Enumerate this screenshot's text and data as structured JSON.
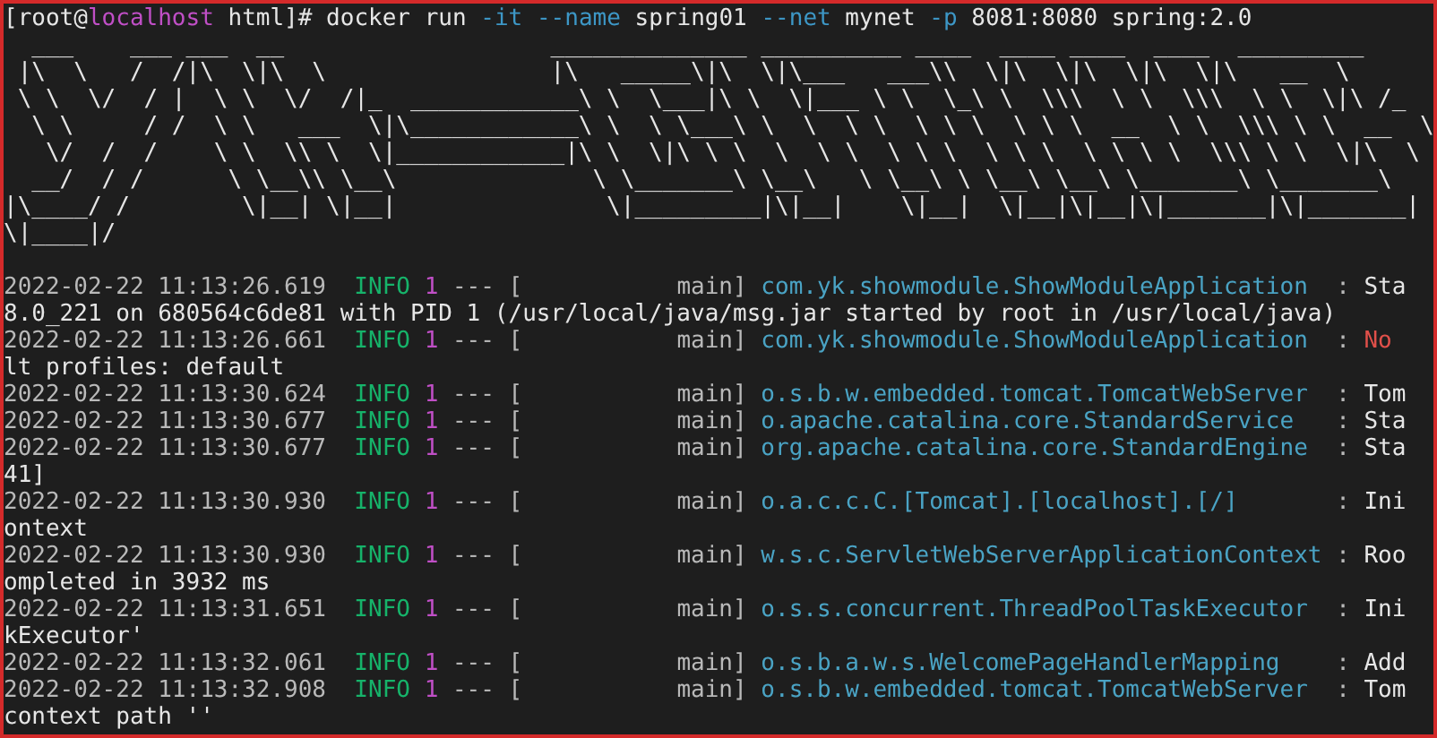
{
  "prompt": {
    "before": "[root@",
    "host": "localhost",
    "after": " html]#"
  },
  "command": [
    {
      "text": "docker",
      "kind": "arg"
    },
    {
      "text": "run",
      "kind": "arg"
    },
    {
      "text": "-it",
      "kind": "flag"
    },
    {
      "text": "--name",
      "kind": "flag"
    },
    {
      "text": "spring01",
      "kind": "arg"
    },
    {
      "text": "--net",
      "kind": "flag"
    },
    {
      "text": "mynet",
      "kind": "arg"
    },
    {
      "text": "-p",
      "kind": "flag"
    },
    {
      "text": "8081:8080",
      "kind": "arg"
    },
    {
      "text": "spring:2.0",
      "kind": "arg"
    }
  ],
  "banner": [
    "  ___    ___ ___  __                   ______________ __________ ____  ____ ____  ____  _________",
    " |\\  \\   /  /|\\  \\|\\  \\                |\\   _____\\|\\  \\|\\___   ___\\\\  \\|\\  \\|\\  \\|\\  \\|\\   __  \\",
    " \\ \\  \\/  / |  \\ \\  \\/  /|_  ____________\\ \\  \\___|\\ \\  \\|___ \\ \\  \\_\\ \\  \\\\\\  \\ \\  \\\\\\  \\ \\  \\|\\ /_",
    "  \\ \\     / /  \\ \\   ___  \\|\\____________\\ \\  \\ \\___\\ \\  \\  \\ \\  \\ \\ \\  \\ \\ \\  __  \\ \\  \\\\\\ \\ \\  __  \\",
    "   \\/  /  /    \\ \\  \\\\ \\  \\|____________|\\ \\  \\|\\ \\ \\  \\  \\ \\  \\ \\ \\  \\ \\ \\  \\ \\ \\ \\  \\\\\\ \\ \\  \\|\\  \\",
    "  __/  / /      \\ \\__\\\\ \\__\\              \\ \\_______\\ \\__\\   \\ \\__\\ \\ \\__\\ \\__\\ \\_______\\ \\_______\\",
    "|\\____/ /        \\|__| \\|__|               \\|_________|\\|__|    \\|__|  \\|__|\\|__|\\|_______|\\|_______|",
    "\\|____|/"
  ],
  "lines": [
    {
      "kind": "log",
      "time": "2022-02-22 11:13:26.619",
      "level": "INFO",
      "pid": "1",
      "sep": "---",
      "thread": "[           main]",
      "logger": "com.yk.showmodule.ShowModuleApplication ",
      "colon": ":",
      "message": "Sta",
      "alert": false
    },
    {
      "kind": "text",
      "text": "8.0_221 on 680564c6de81 with PID 1 (/usr/local/java/msg.jar started by root in /usr/local/java)"
    },
    {
      "kind": "log",
      "time": "2022-02-22 11:13:26.661",
      "level": "INFO",
      "pid": "1",
      "sep": "---",
      "thread": "[           main]",
      "logger": "com.yk.showmodule.ShowModuleApplication ",
      "colon": ":",
      "message": "No",
      "alert": true
    },
    {
      "kind": "text",
      "text": "lt profiles: default"
    },
    {
      "kind": "log",
      "time": "2022-02-22 11:13:30.624",
      "level": "INFO",
      "pid": "1",
      "sep": "---",
      "thread": "[           main]",
      "logger": "o.s.b.w.embedded.tomcat.TomcatWebServer ",
      "colon": ":",
      "message": "Tom",
      "alert": false
    },
    {
      "kind": "log",
      "time": "2022-02-22 11:13:30.677",
      "level": "INFO",
      "pid": "1",
      "sep": "---",
      "thread": "[           main]",
      "logger": "o.apache.catalina.core.StandardService  ",
      "colon": ":",
      "message": "Sta",
      "alert": false
    },
    {
      "kind": "log",
      "time": "2022-02-22 11:13:30.677",
      "level": "INFO",
      "pid": "1",
      "sep": "---",
      "thread": "[           main]",
      "logger": "org.apache.catalina.core.StandardEngine ",
      "colon": ":",
      "message": "Sta",
      "alert": false
    },
    {
      "kind": "text",
      "text": "41]"
    },
    {
      "kind": "log",
      "time": "2022-02-22 11:13:30.930",
      "level": "INFO",
      "pid": "1",
      "sep": "---",
      "thread": "[           main]",
      "logger": "o.a.c.c.C.[Tomcat].[localhost].[/]      ",
      "colon": ":",
      "message": "Ini",
      "alert": false
    },
    {
      "kind": "text",
      "text": "ontext"
    },
    {
      "kind": "log",
      "time": "2022-02-22 11:13:30.930",
      "level": "INFO",
      "pid": "1",
      "sep": "---",
      "thread": "[           main]",
      "logger": "w.s.c.ServletWebServerApplicationContext",
      "colon": ":",
      "message": "Roo",
      "alert": false
    },
    {
      "kind": "text",
      "text": "ompleted in 3932 ms"
    },
    {
      "kind": "log",
      "time": "2022-02-22 11:13:31.651",
      "level": "INFO",
      "pid": "1",
      "sep": "---",
      "thread": "[           main]",
      "logger": "o.s.s.concurrent.ThreadPoolTaskExecutor ",
      "colon": ":",
      "message": "Ini",
      "alert": false
    },
    {
      "kind": "text",
      "text": "kExecutor'"
    },
    {
      "kind": "log",
      "time": "2022-02-22 11:13:32.061",
      "level": "INFO",
      "pid": "1",
      "sep": "---",
      "thread": "[           main]",
      "logger": "o.s.b.a.w.s.WelcomePageHandlerMapping   ",
      "colon": ":",
      "message": "Add",
      "alert": false
    },
    {
      "kind": "log",
      "time": "2022-02-22 11:13:32.908",
      "level": "INFO",
      "pid": "1",
      "sep": "---",
      "thread": "[           main]",
      "logger": "o.s.b.w.embedded.tomcat.TomcatWebServer ",
      "colon": ":",
      "message": "Tom",
      "alert": false
    },
    {
      "kind": "text",
      "text": "context path ''"
    }
  ]
}
